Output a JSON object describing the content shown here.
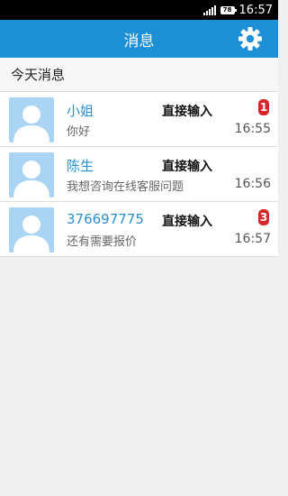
{
  "status_bar": {
    "battery": "78",
    "time": "16:57"
  },
  "app_bar": {
    "title": "消息",
    "settings_icon": "gear-icon"
  },
  "section": {
    "title": "今天消息"
  },
  "colors": {
    "accent": "#1d8fd6",
    "sender": "#2a8fd0",
    "badge": "#d7262a",
    "avatar": "#a9d4f3"
  },
  "messages": [
    {
      "sender": "小姐",
      "preview": "你好",
      "mode": "直接输入",
      "time": "16:55",
      "badge": "1"
    },
    {
      "sender": "陈生",
      "preview": "我想咨询在线客服问题",
      "mode": "直接输入",
      "time": "16:56",
      "badge": ""
    },
    {
      "sender": "376697775",
      "preview": "还有需要报价",
      "mode": "直接输入",
      "time": "16:57",
      "badge": "3"
    }
  ]
}
